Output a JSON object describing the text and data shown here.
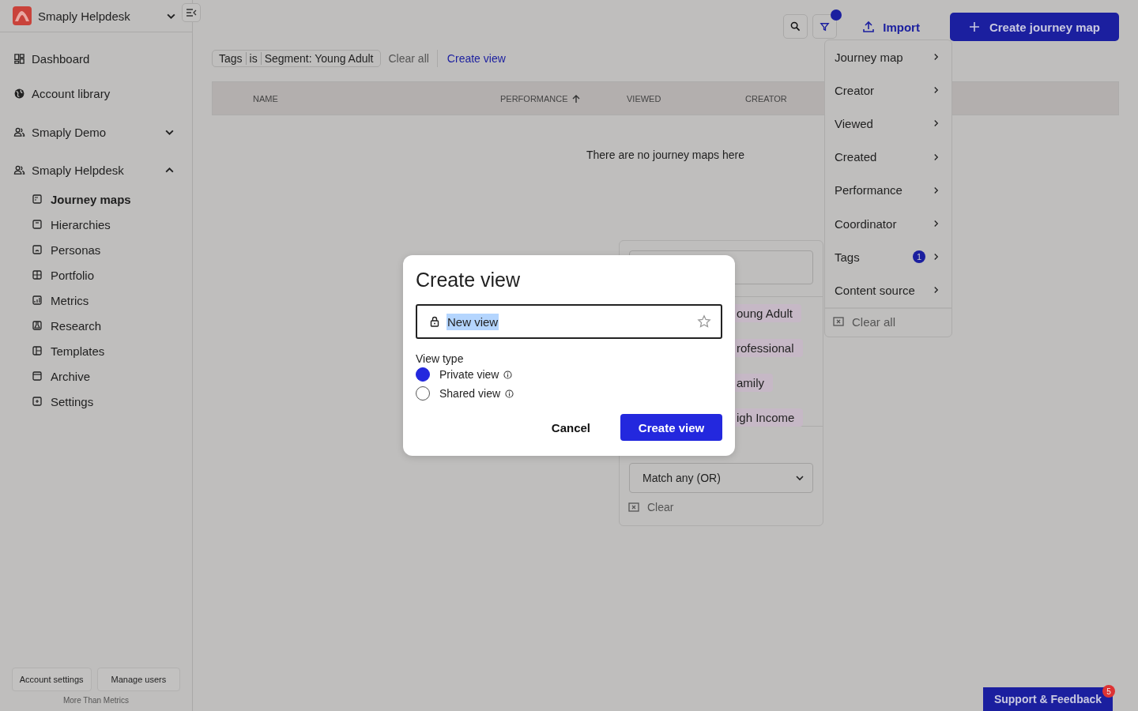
{
  "sidebar": {
    "workspace": "Smaply Helpdesk",
    "nav": [
      {
        "label": "Dashboard"
      },
      {
        "label": "Account library"
      }
    ],
    "groups": [
      {
        "label": "Smaply Demo",
        "expanded": false
      },
      {
        "label": "Smaply Helpdesk",
        "expanded": true,
        "children": [
          {
            "label": "Journey maps",
            "selected": true
          },
          {
            "label": "Hierarchies",
            "selected": false
          },
          {
            "label": "Personas",
            "selected": false
          },
          {
            "label": "Portfolio",
            "selected": false
          },
          {
            "label": "Metrics",
            "selected": false
          },
          {
            "label": "Research",
            "selected": false
          },
          {
            "label": "Templates",
            "selected": false
          },
          {
            "label": "Archive",
            "selected": false
          },
          {
            "label": "Settings",
            "selected": false
          }
        ]
      }
    ],
    "footer_buttons": [
      "Account settings",
      "Manage users"
    ],
    "tagline": "More Than Metrics"
  },
  "toolbar": {
    "filter_active": true,
    "import": "Import",
    "create": "Create journey map"
  },
  "filter_bar": {
    "chip": {
      "field": "Tags",
      "operator": "is",
      "value": "Segment: Young Adult"
    },
    "clear": "Clear all",
    "create_view": "Create view"
  },
  "table": {
    "columns": [
      {
        "label": "NAME",
        "sorted": false
      },
      {
        "label": "PERFORMANCE",
        "sorted": true
      },
      {
        "label": "VIEWED",
        "sorted": false
      },
      {
        "label": "CREATOR",
        "sorted": false
      }
    ],
    "empty": "There are no journey maps here"
  },
  "filter_menu": {
    "items": [
      {
        "label": "Journey map"
      },
      {
        "label": "Creator"
      },
      {
        "label": "Viewed"
      },
      {
        "label": "Created"
      },
      {
        "label": "Performance"
      },
      {
        "label": "Coordinator"
      },
      {
        "label": "Tags",
        "count": "1"
      },
      {
        "label": "Content source"
      }
    ],
    "clear": "Clear all"
  },
  "tag_popover": {
    "tags": [
      "oung Adult",
      "rofessional",
      "amily",
      "igh Income"
    ],
    "match": "Match any (OR)",
    "clear": "Clear"
  },
  "dialog": {
    "title": "Create view",
    "name_value": "New view",
    "view_type_label": "View type",
    "options": [
      {
        "label": "Private view",
        "selected": true
      },
      {
        "label": "Shared view",
        "selected": false
      }
    ],
    "cancel": "Cancel",
    "confirm": "Create view"
  },
  "support": {
    "label": "Support & Feedback",
    "badge": "5"
  }
}
